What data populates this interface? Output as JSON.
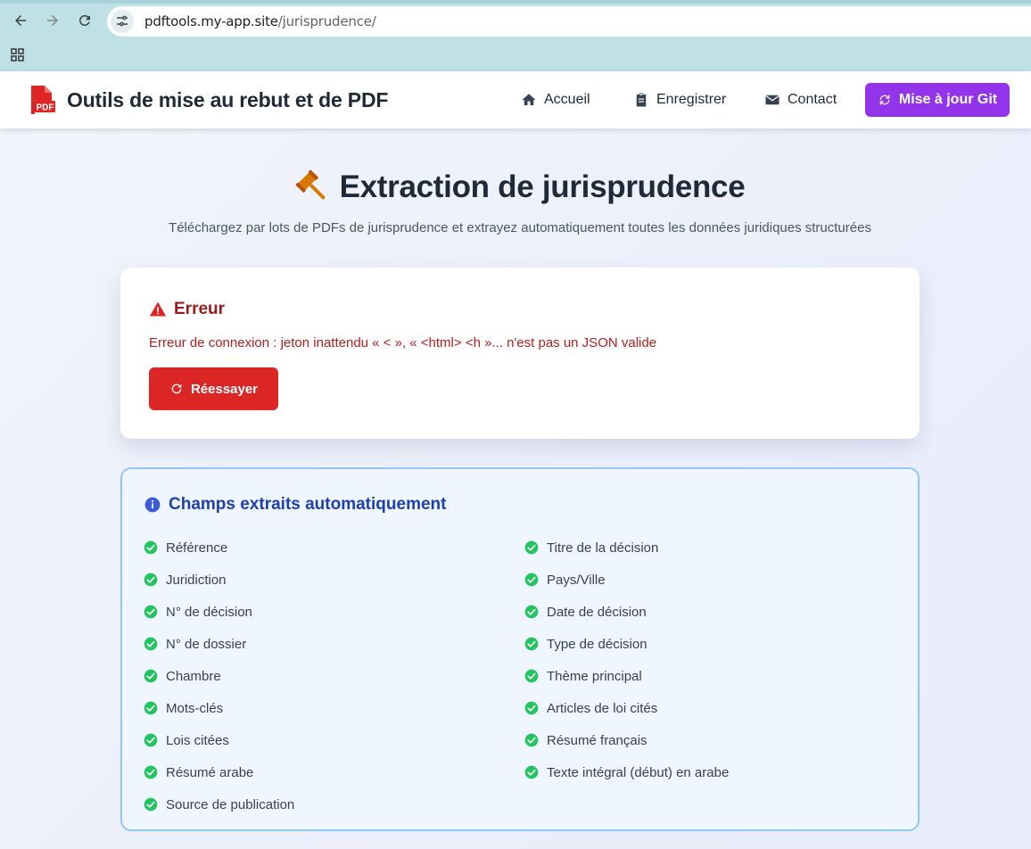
{
  "browser": {
    "url_host": "pdftools.my-app.site",
    "url_path": "/jurisprudence/"
  },
  "header": {
    "app_title": "Outils de mise au rebut et de PDF",
    "nav": [
      {
        "label": "Accueil",
        "icon": "home-icon"
      },
      {
        "label": "Enregistrer",
        "icon": "clipboard-icon"
      },
      {
        "label": "Contact",
        "icon": "envelope-icon"
      }
    ],
    "git_button": "Mise à jour Git"
  },
  "main": {
    "title": "Extraction de jurisprudence",
    "subtitle": "Téléchargez par lots de PDFs de jurisprudence et extrayez automatiquement toutes les données juridiques structurées",
    "error": {
      "heading": "Erreur",
      "message": "Erreur de connexion : jeton inattendu « < », « <html>  <h »... n'est pas un JSON valide",
      "retry_label": "Réessayer"
    },
    "fields_panel": {
      "heading": "Champs extraits automatiquement",
      "left": [
        "Référence",
        "Juridiction",
        "N° de décision",
        "N° de dossier",
        "Chambre",
        "Mots-clés",
        "Lois citées",
        "Résumé arabe",
        "Source de publication"
      ],
      "right": [
        "Titre de la décision",
        "Pays/Ville",
        "Date de décision",
        "Type de décision",
        "Thème principal",
        "Articles de loi cités",
        "Résumé français",
        "Texte intégral (début) en arabe"
      ]
    }
  },
  "colors": {
    "accent_purple": "#9333ea",
    "error_red": "#dc2626",
    "info_blue": "#1e40af",
    "check_green": "#22c55e",
    "gavel_orange": "#d97706"
  }
}
